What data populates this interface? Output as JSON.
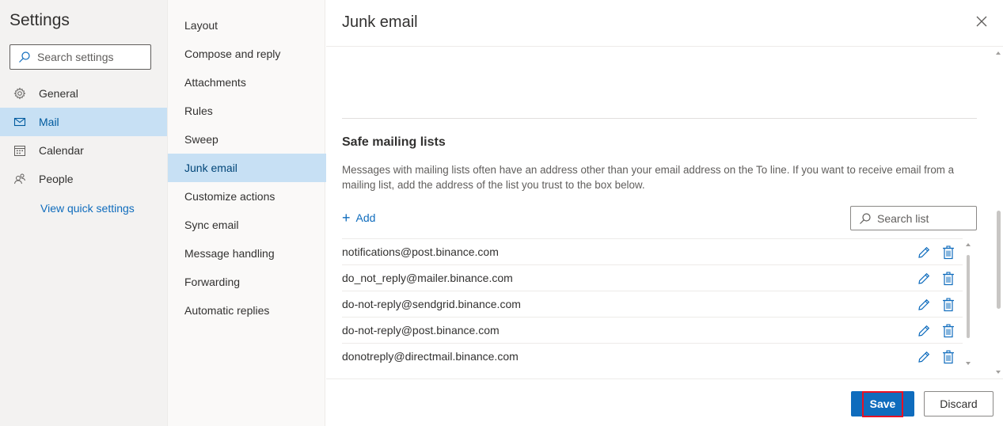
{
  "settings": {
    "title": "Settings",
    "search_placeholder": "Search settings"
  },
  "nav1": {
    "items": [
      {
        "label": "General",
        "icon": "gear-icon"
      },
      {
        "label": "Mail",
        "icon": "mail-icon",
        "active": true
      },
      {
        "label": "Calendar",
        "icon": "calendar-icon"
      },
      {
        "label": "People",
        "icon": "people-icon"
      }
    ],
    "quick_link": "View quick settings"
  },
  "nav2": {
    "items": [
      {
        "label": "Layout"
      },
      {
        "label": "Compose and reply"
      },
      {
        "label": "Attachments"
      },
      {
        "label": "Rules"
      },
      {
        "label": "Sweep"
      },
      {
        "label": "Junk email",
        "active": true
      },
      {
        "label": "Customize actions"
      },
      {
        "label": "Sync email"
      },
      {
        "label": "Message handling"
      },
      {
        "label": "Forwarding"
      },
      {
        "label": "Automatic replies"
      }
    ]
  },
  "main": {
    "title": "Junk email",
    "section_title": "Safe mailing lists",
    "section_desc": "Messages with mailing lists often have an address other than your email address on the To line. If you want to receive email from a mailing list, add the address of the list you trust to the box below.",
    "add_label": "Add",
    "search_list_placeholder": "Search list",
    "list": [
      "notifications@post.binance.com",
      "do_not_reply@mailer.binance.com",
      "do-not-reply@sendgrid.binance.com",
      "do-not-reply@post.binance.com",
      "donotreply@directmail.binance.com"
    ]
  },
  "footer": {
    "save_label": "Save",
    "discard_label": "Discard"
  },
  "colors": {
    "accent": "#0f6cbd",
    "active_bg": "#c7e0f4",
    "highlight": "#e81123"
  }
}
